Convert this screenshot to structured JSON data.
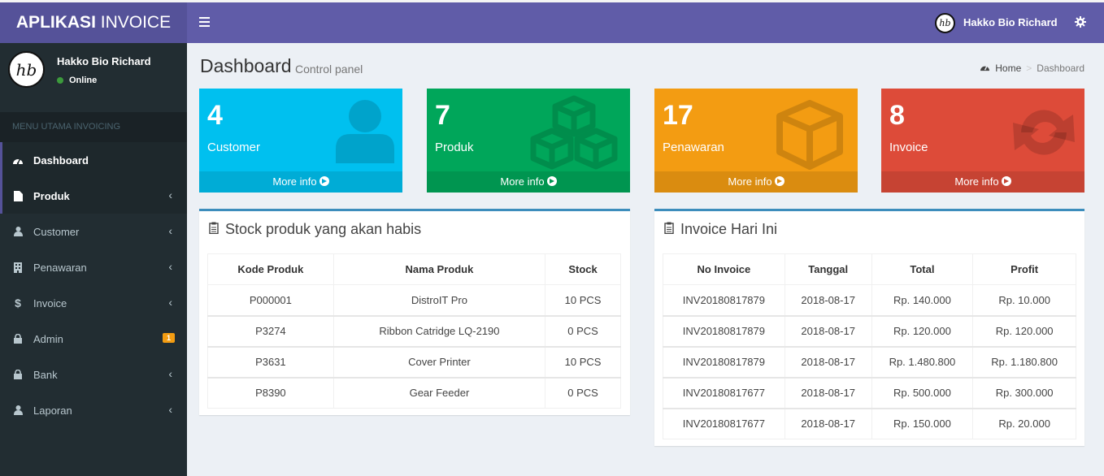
{
  "app": {
    "title_bold": "APLIKASI",
    "title_rest": " INVOICE"
  },
  "user": {
    "name": "Hakko Bio Richard",
    "status": "Online",
    "avatar_text": "hb"
  },
  "sidebar": {
    "header": "MENU UTAMA INVOICING",
    "items": [
      {
        "label": "Dashboard",
        "icon": "dashboard-icon"
      },
      {
        "label": "Produk",
        "icon": "file-icon"
      },
      {
        "label": "Customer",
        "icon": "user-icon"
      },
      {
        "label": "Penawaran",
        "icon": "building-icon"
      },
      {
        "label": "Invoice",
        "icon": "dollar-icon"
      },
      {
        "label": "Admin",
        "icon": "lock-icon",
        "badge": "1"
      },
      {
        "label": "Bank",
        "icon": "lock-icon"
      },
      {
        "label": "Laporan",
        "icon": "user-icon"
      }
    ]
  },
  "header": {
    "title": "Dashboard",
    "subtitle": "Control panel"
  },
  "breadcrumb": {
    "home": "Home",
    "current": "Dashboard"
  },
  "stats": [
    {
      "value": "4",
      "label": "Customer",
      "more": "More info",
      "color": "#00c0ef"
    },
    {
      "value": "7",
      "label": "Produk",
      "more": "More info",
      "color": "#00a65a"
    },
    {
      "value": "17",
      "label": "Penawaran",
      "more": "More info",
      "color": "#f39c12"
    },
    {
      "value": "8",
      "label": "Invoice",
      "more": "More info",
      "color": "#dd4b39"
    }
  ],
  "stock": {
    "title": "Stock produk yang akan habis",
    "columns": [
      "Kode Produk",
      "Nama Produk",
      "Stock"
    ],
    "rows": [
      [
        "P000001",
        "DistroIT Pro",
        "10 PCS"
      ],
      [
        "P3274",
        "Ribbon Catridge LQ-2190",
        "0 PCS"
      ],
      [
        "P3631",
        "Cover Printer",
        "10 PCS"
      ],
      [
        "P8390",
        "Gear Feeder",
        "0 PCS"
      ]
    ]
  },
  "invoices": {
    "title": "Invoice Hari Ini",
    "columns": [
      "No Invoice",
      "Tanggal",
      "Total",
      "Profit"
    ],
    "rows": [
      [
        "INV20180817879",
        "2018-08-17",
        "Rp. 140.000",
        "Rp. 10.000"
      ],
      [
        "INV20180817879",
        "2018-08-17",
        "Rp. 120.000",
        "Rp. 120.000"
      ],
      [
        "INV20180817879",
        "2018-08-17",
        "Rp. 1.480.800",
        "Rp. 1.180.800"
      ],
      [
        "INV20180817677",
        "2018-08-17",
        "Rp. 500.000",
        "Rp. 300.000"
      ],
      [
        "INV20180817677",
        "2018-08-17",
        "Rp. 150.000",
        "Rp. 20.000"
      ]
    ]
  }
}
